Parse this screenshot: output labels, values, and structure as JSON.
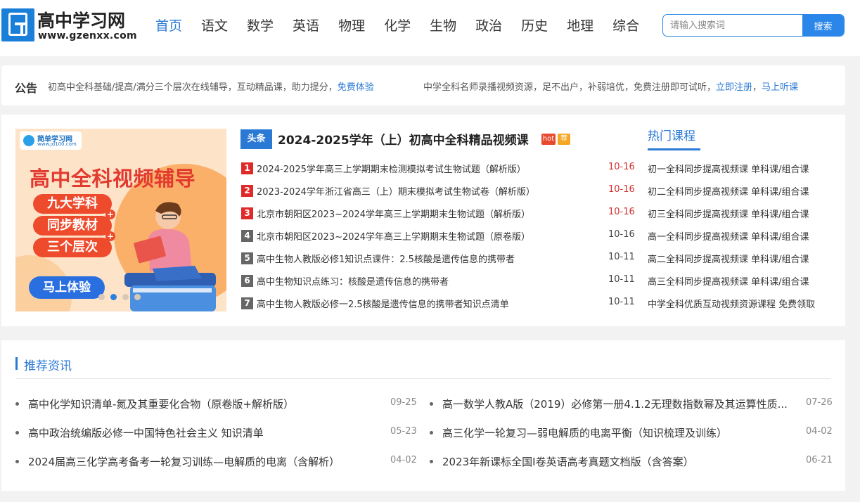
{
  "header": {
    "logo_title": "高中学习网",
    "logo_url": "www.gzenxx.com",
    "nav": [
      "首页",
      "语文",
      "数学",
      "英语",
      "物理",
      "化学",
      "生物",
      "政治",
      "历史",
      "地理",
      "综合"
    ],
    "active_nav": "首页",
    "search_placeholder": "请输入搜索词",
    "search_button": "搜索"
  },
  "notice": {
    "title": "公告",
    "text1": "初高中全科基础/提高/满分三个层次在线辅导，互动精品课，助力提分，",
    "link1": "免费体验",
    "text2": "中学全科名师录播视频资源，足不出户，补弱培优，免费注册即可试听，",
    "link2": "立即注册",
    "sep": "，",
    "link3": "马上听课"
  },
  "banner": {
    "brand_name": "简单学习网",
    "brand_url": "www.jd100.com",
    "headline": "高中全科视频辅导",
    "pills": [
      "九大学科",
      "同步教材",
      "三个层次"
    ],
    "cta": "马上体验",
    "slide_count": 4,
    "active_slide": 2
  },
  "headlines": {
    "tag": "头条",
    "title": "2024-2025学年（上）初高中全科精品视频课",
    "badge_hot": "hot",
    "badge_rec": "荐",
    "items": [
      {
        "num": "1",
        "text": "2024-2025学年高三上学期期末检测模拟考试生物试题（解析版）",
        "date": "10-16",
        "highlight": true
      },
      {
        "num": "2",
        "text": "2023-2024学年浙江省高三（上）期末模拟考试生物试卷（解析版）",
        "date": "10-16",
        "highlight": true
      },
      {
        "num": "3",
        "text": "北京市朝阳区2023~2024学年高三上学期期末生物试题（解析版）",
        "date": "10-16",
        "highlight": true
      },
      {
        "num": "4",
        "text": "北京市朝阳区2023~2024学年高三上学期期末生物试题（原卷版）",
        "date": "10-16",
        "highlight": false
      },
      {
        "num": "5",
        "text": "高中生物人教版必修1知识点课件：2.5核酸是遗传信息的携带者",
        "date": "10-11",
        "highlight": false
      },
      {
        "num": "6",
        "text": "高中生物知识点练习：核酸是遗传信息的携带者",
        "date": "10-11",
        "highlight": false
      },
      {
        "num": "7",
        "text": "高中生物人教版必修一2.5核酸是遗传信息的携带者知识点清单",
        "date": "10-11",
        "highlight": false
      }
    ]
  },
  "hot_courses": {
    "title": "热门课程",
    "items": [
      "初一全科同步提高视频课 单科课/组合课",
      "初二全科同步提高视频课 单科课/组合课",
      "初三全科同步提高视频课 单科课/组合课",
      "高一全科同步提高视频课 单科课/组合课",
      "高二全科同步提高视频课 单科课/组合课",
      "高三全科同步提高视频课 单科课/组合课",
      "中学全科优质互动视频资源课程 免费领取"
    ]
  },
  "recommend": {
    "title": "推荐资讯",
    "left": [
      {
        "text": "高中化学知识清单-氮及其重要化合物（原卷版+解析版）",
        "date": "09-25"
      },
      {
        "text": "高中政治统编版必修一中国特色社会主义 知识清单",
        "date": "05-23"
      },
      {
        "text": "2024届高三化学高考备考一轮复习训练—电解质的电离（含解析）",
        "date": "04-02"
      }
    ],
    "right": [
      {
        "text": "高一数学人教A版（2019）必修第一册4.1.2无理数指数幂及其运算性质...",
        "date": "07-26"
      },
      {
        "text": "高三化学一轮复习—弱电解质的电离平衡（知识梳理及训练）",
        "date": "04-02"
      },
      {
        "text": "2023年新课标全国Ⅰ卷英语高考真题文档版（含答案）",
        "date": "06-21"
      }
    ]
  }
}
